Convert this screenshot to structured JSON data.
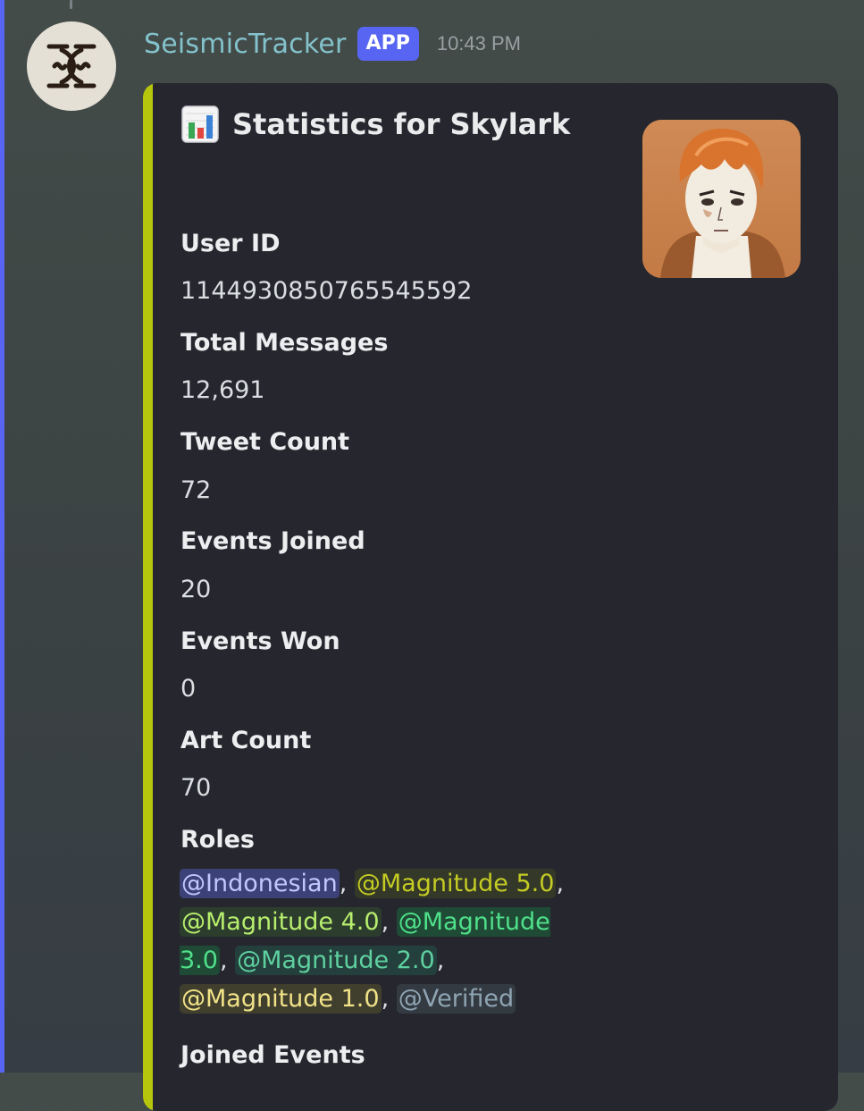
{
  "message": {
    "bot_name": "SeismicTracker",
    "badge": "APP",
    "timestamp": "10:43 PM"
  },
  "colors": {
    "embed_accent": "#b6c60d",
    "app_badge": "#5865f2",
    "bot_name": "#84c2cc"
  },
  "embed": {
    "title_icon": "bar-chart-icon",
    "title": "Statistics for Skylark",
    "fields": [
      {
        "name": "User ID",
        "value": "1144930850765545592"
      },
      {
        "name": "Total Messages",
        "value": "12,691"
      },
      {
        "name": "Tweet Count",
        "value": "72"
      },
      {
        "name": "Events Joined",
        "value": "20"
      },
      {
        "name": "Events Won",
        "value": "0"
      },
      {
        "name": "Art Count",
        "value": "70"
      }
    ],
    "roles_label": "Roles",
    "roles": [
      {
        "label": "@Indonesian",
        "color": "#c2c7ff"
      },
      {
        "label": "@Magnitude 5.0",
        "color": "#c4cb23"
      },
      {
        "label": "@Magnitude 4.0",
        "color": "#b7ee6d"
      },
      {
        "label": "@Magnitude 3.0",
        "color": "#4fe08a"
      },
      {
        "label": "@Magnitude 2.0",
        "color": "#5ed0a0"
      },
      {
        "label": "@Magnitude 1.0",
        "color": "#f1e388"
      },
      {
        "label": "@Verified",
        "color": "#8fa4b2"
      }
    ],
    "joined_events_label": "Joined Events"
  }
}
